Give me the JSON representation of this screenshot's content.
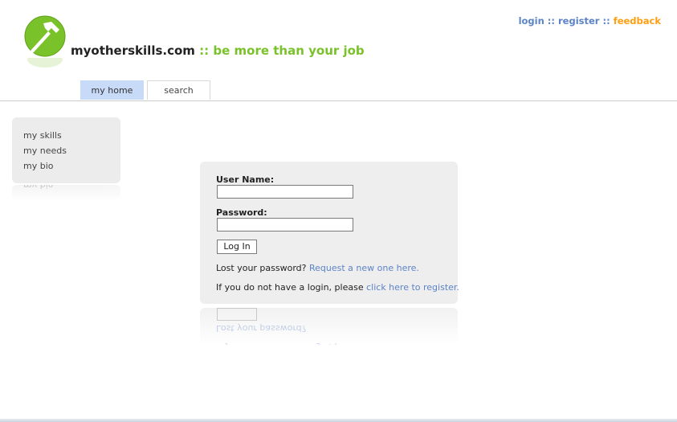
{
  "header": {
    "site_name": "myotherskills.com",
    "separator": " :: ",
    "slogan": "be more than your job",
    "links": {
      "login": "login",
      "register": "register",
      "feedback": "feedback",
      "divider": " :: "
    }
  },
  "tabs": [
    {
      "label": "my home",
      "active": true
    },
    {
      "label": "search",
      "active": false
    }
  ],
  "sidebar": {
    "items": [
      {
        "label": "my skills"
      },
      {
        "label": "my needs"
      },
      {
        "label": "my bio"
      }
    ]
  },
  "login": {
    "username_label": "User Name:",
    "username_value": "",
    "password_label": "Password:",
    "password_value": "",
    "button_label": "Log In",
    "lost_text": "Lost your password?",
    "lost_link": "Request a new one here.",
    "no_login_text": "If you do not have a login, please",
    "register_link": "click here to register."
  },
  "colors": {
    "accent_green": "#7ac22a",
    "link_blue": "#5b83c6",
    "feedback_orange": "#ff9e10",
    "tab_active": "#c7daf8"
  }
}
